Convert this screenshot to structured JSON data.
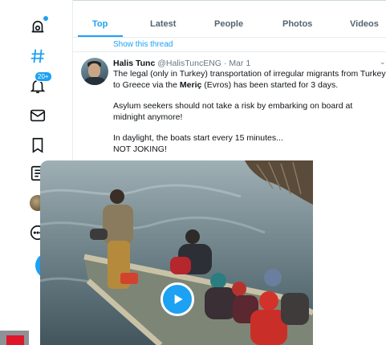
{
  "nav": {
    "icons": [
      "notification-settings-icon",
      "hashtag-icon",
      "notifications-bell-icon",
      "messages-icon",
      "bookmarks-icon",
      "lists-icon",
      "profile-avatar",
      "more-icon",
      "compose-tweet-icon"
    ],
    "notifications_badge": "20+"
  },
  "tabs": [
    {
      "label": "Top",
      "active": true
    },
    {
      "label": "Latest",
      "active": false
    },
    {
      "label": "People",
      "active": false
    },
    {
      "label": "Photos",
      "active": false
    },
    {
      "label": "Videos",
      "active": false
    }
  ],
  "thread_link": "Show this thread",
  "tweet": {
    "name": "Halis Tunc",
    "handle": "@HalisTuncENG",
    "separator": "·",
    "date": "Mar 1",
    "line1_pre": "The legal (only in Turkey) transportation of irregular migrants from Turkey to Greece via the ",
    "line1_bold": "Meriç",
    "line1_post": " (Evros) has been started for 3 days.",
    "para2": "Asylum seekers should not take a risk by embarking on board at midnight anymore!",
    "para3a": "In daylight, the boats start every 15 minutes...",
    "para3b": "NOT JOKING!"
  },
  "colors": {
    "accent": "#1da1f2",
    "text": "#0f1419",
    "muted": "#657786",
    "border": "#e6ecf0"
  }
}
